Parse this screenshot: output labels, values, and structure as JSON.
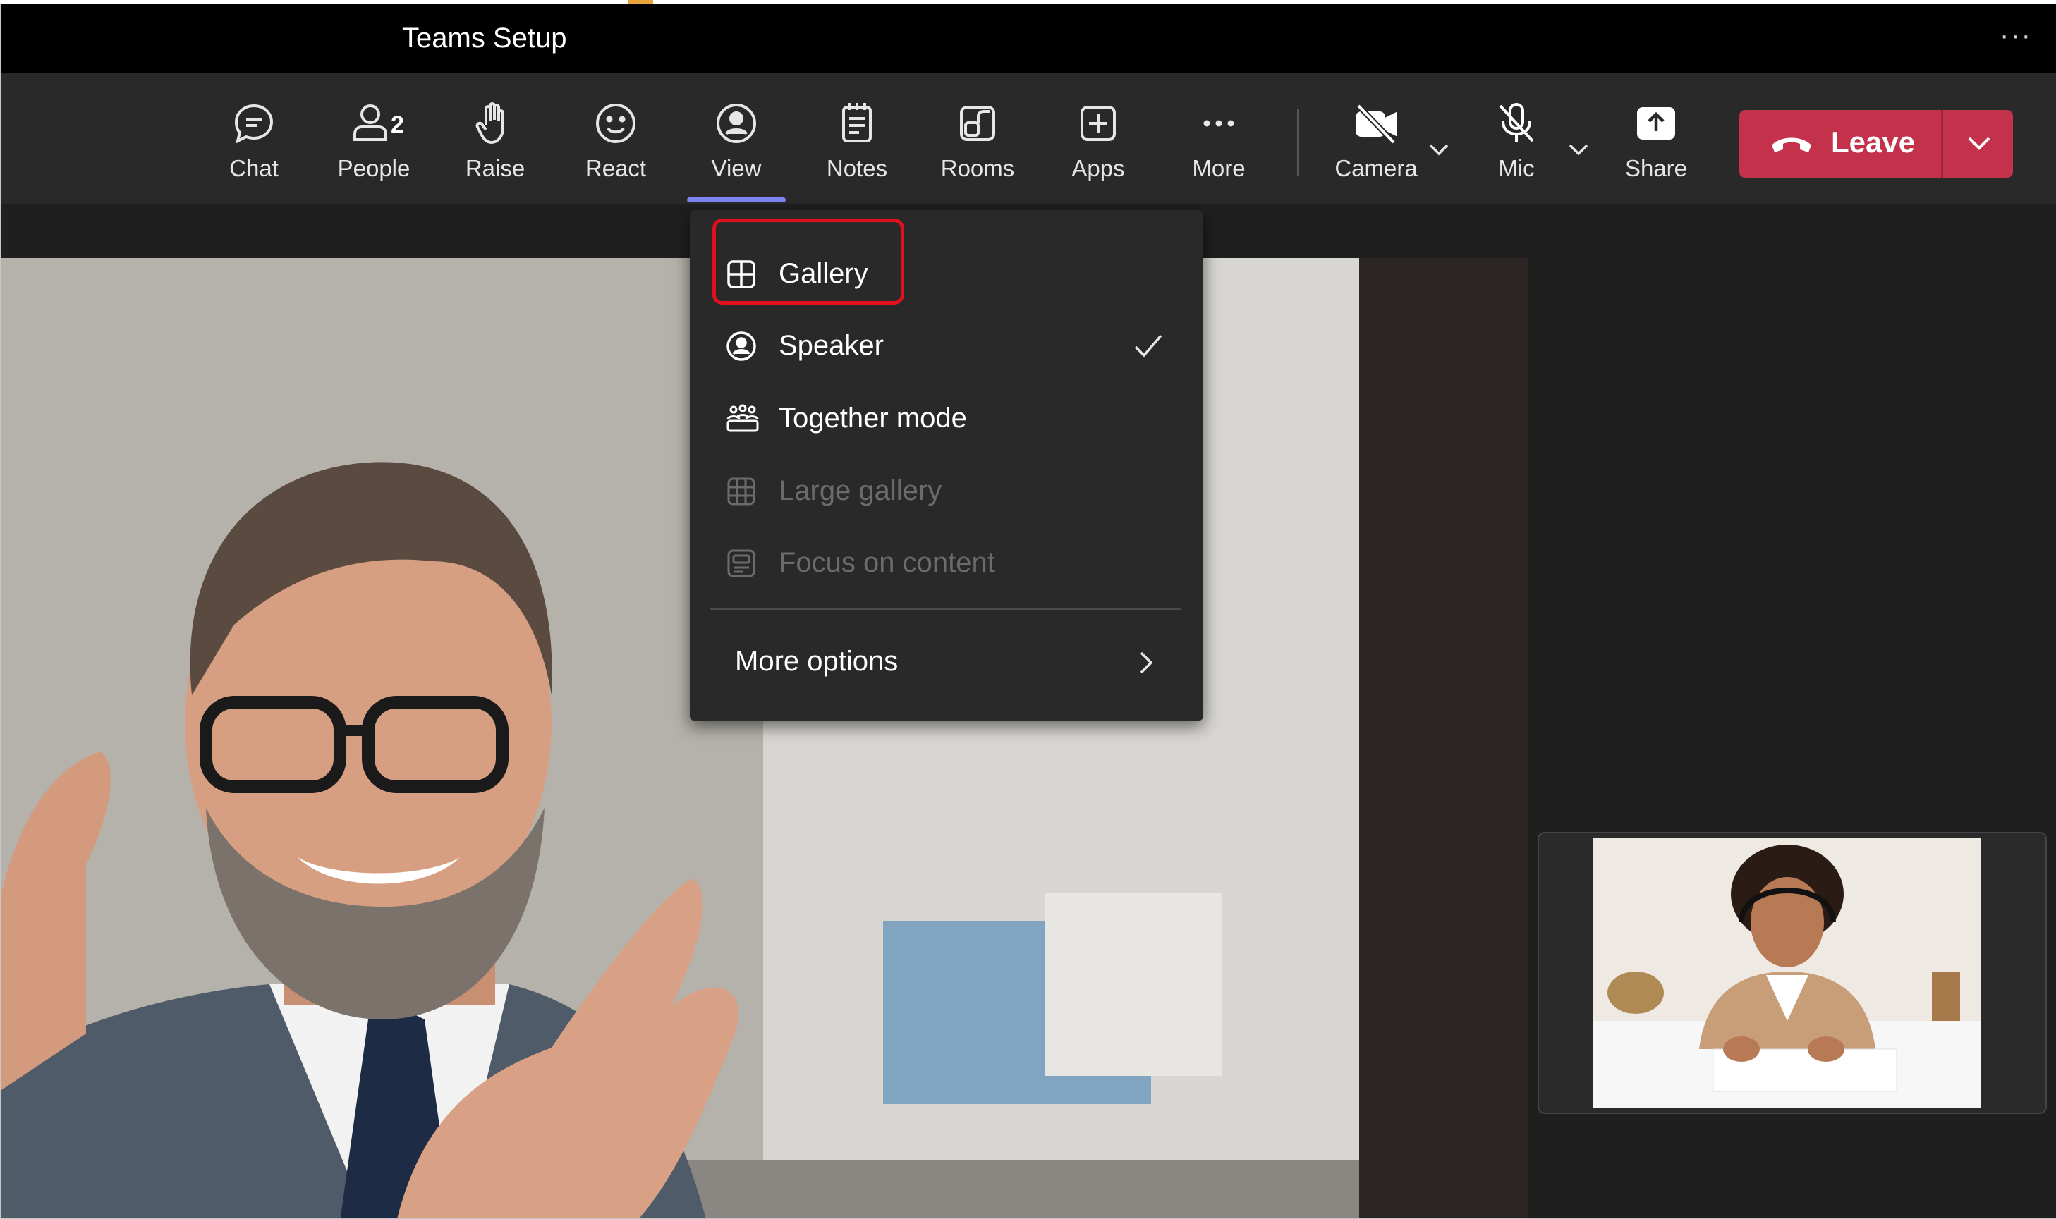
{
  "window": {
    "title": "Teams Setup",
    "more_label": "···"
  },
  "toolbar": {
    "chat": "Chat",
    "people": "People",
    "people_count": "2",
    "raise": "Raise",
    "react": "React",
    "view": "View",
    "notes": "Notes",
    "rooms": "Rooms",
    "apps": "Apps",
    "more": "More",
    "camera": "Camera",
    "mic": "Mic",
    "share": "Share",
    "leave": "Leave"
  },
  "view_menu": {
    "items": [
      {
        "label": "Gallery",
        "icon": "grid-icon",
        "state": "highlighted"
      },
      {
        "label": "Speaker",
        "icon": "person-circle-icon",
        "checked": true
      },
      {
        "label": "Together mode",
        "icon": "people-group-icon"
      },
      {
        "label": "Large gallery",
        "icon": "large-grid-icon",
        "disabled": true
      },
      {
        "label": "Focus on content",
        "icon": "focus-content-icon",
        "disabled": true
      }
    ],
    "more_options": "More options"
  },
  "colors": {
    "leave_button": "#c4314b",
    "view_underline": "#7f85f5",
    "highlight_box": "#e0101f",
    "toolbar_bg": "#292929",
    "titlebar_bg": "#000000"
  }
}
